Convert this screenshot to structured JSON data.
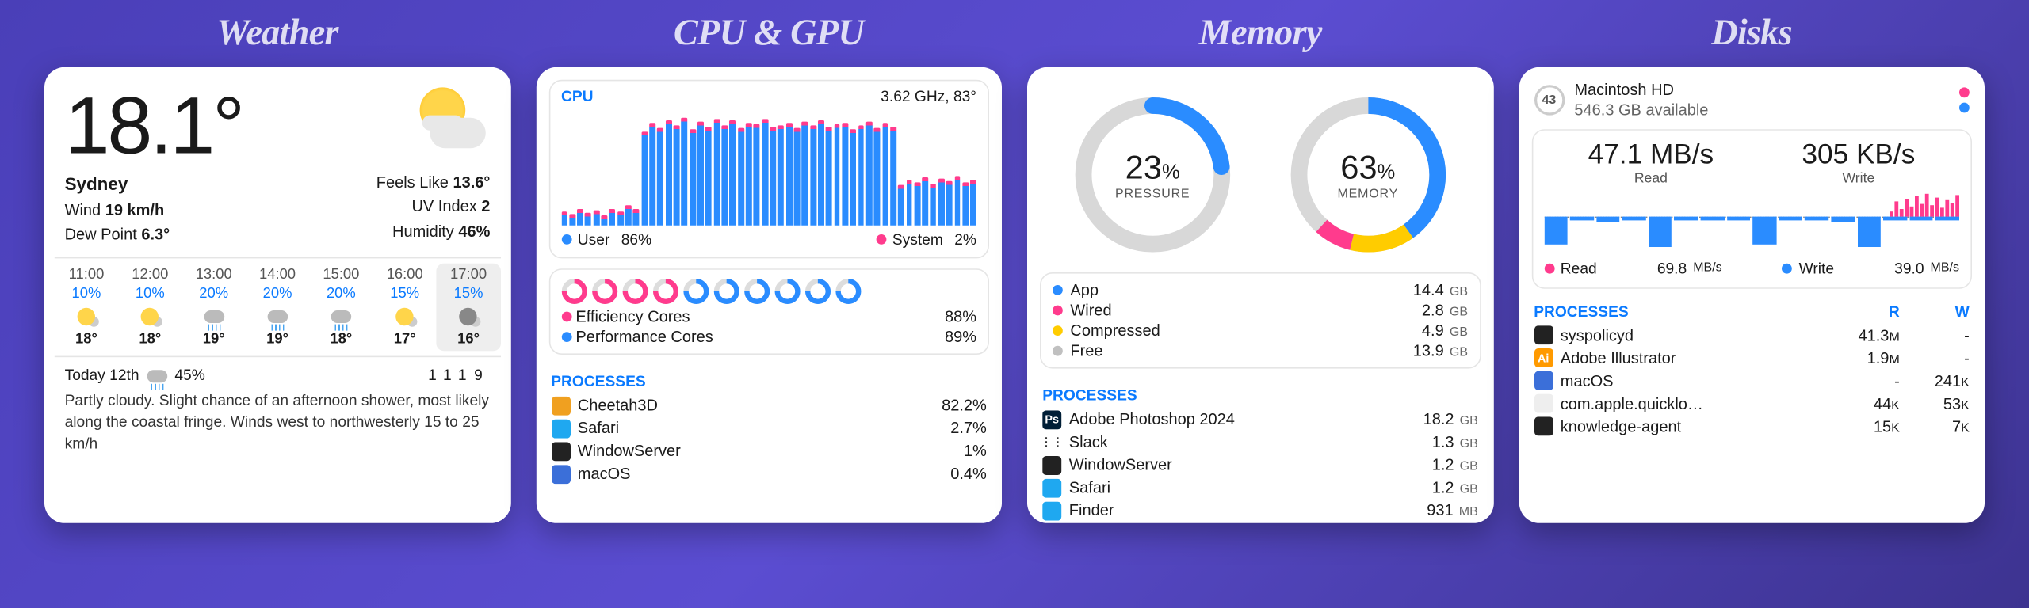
{
  "titles": {
    "weather": "Weather",
    "cpu": "CPU & GPU",
    "memory": "Memory",
    "disks": "Disks"
  },
  "weather": {
    "temp": "18.1°",
    "location": "Sydney",
    "wind_label": "Wind ",
    "wind": "19 km/h",
    "dew_label": "Dew Point ",
    "dew": "6.3°",
    "feels_label": "Feels Like ",
    "feels": "13.6°",
    "uv_label": "UV Index ",
    "uv": "2",
    "hum_label": "Humidity ",
    "hum": "46%",
    "hourly": [
      {
        "time": "11:00",
        "pop": "10%",
        "ico": "sun",
        "t": "18°"
      },
      {
        "time": "12:00",
        "pop": "10%",
        "ico": "sun",
        "t": "18°"
      },
      {
        "time": "13:00",
        "pop": "20%",
        "ico": "rain",
        "t": "19°"
      },
      {
        "time": "14:00",
        "pop": "20%",
        "ico": "rain",
        "t": "19°"
      },
      {
        "time": "15:00",
        "pop": "20%",
        "ico": "rain",
        "t": "18°"
      },
      {
        "time": "16:00",
        "pop": "15%",
        "ico": "sun",
        "t": "17°"
      },
      {
        "time": "17:00",
        "pop": "15%",
        "ico": "moon",
        "t": "16°",
        "sel": true
      }
    ],
    "today_label": "Today 12th",
    "today_pop": "45%",
    "today_lo": "11",
    "today_hi": "19",
    "today_text": "Partly cloudy. Slight chance of an afternoon shower, most likely along the coastal fringe. Winds west to northwesterly 15 to 25 km/h"
  },
  "cpu": {
    "label": "CPU",
    "freq": "3.62 GHz, 83°",
    "bars": [
      12,
      10,
      14,
      11,
      13,
      9,
      15,
      12,
      18,
      14,
      82,
      90,
      86,
      92,
      88,
      94,
      85,
      91,
      87,
      93,
      88,
      92,
      86,
      90,
      89,
      93,
      87,
      88,
      90,
      86,
      91,
      88,
      92,
      87,
      89,
      90,
      85,
      88,
      91,
      86,
      90,
      87,
      36,
      40,
      38,
      42,
      37,
      41,
      39,
      43,
      38,
      40
    ],
    "user_label": "User",
    "user_pct": "86%",
    "system_label": "System",
    "system_pct": "2%",
    "rings": [
      "p",
      "p",
      "p",
      "p",
      "b",
      "b",
      "b",
      "b",
      "b",
      "b"
    ],
    "eff_label": "Efficiency Cores",
    "eff_pct": "88%",
    "perf_label": "Performance Cores",
    "perf_pct": "89%",
    "processes_label": "PROCESSES",
    "processes": [
      {
        "name": "Cheetah3D",
        "val": "82.2%",
        "color": "#f0a020"
      },
      {
        "name": "Safari",
        "val": "2.7%",
        "color": "#1fa8f0"
      },
      {
        "name": "WindowServer",
        "val": "1%",
        "color": "#222"
      },
      {
        "name": "macOS",
        "val": "0.4%",
        "color": "#3b6fd9"
      }
    ]
  },
  "memory": {
    "pressure_val": "23",
    "pressure_unit": "%",
    "pressure_label": "PRESSURE",
    "memory_val": "63",
    "memory_unit": "%",
    "memory_label": "MEMORY",
    "rows": [
      {
        "dot": "d-blue",
        "lbl": "App",
        "val": "14.4",
        "unit": "GB"
      },
      {
        "dot": "d-pink",
        "lbl": "Wired",
        "val": "2.8",
        "unit": "GB"
      },
      {
        "dot": "d-yellow",
        "lbl": "Compressed",
        "val": "4.9",
        "unit": "GB"
      },
      {
        "dot": "d-grey",
        "lbl": "Free",
        "val": "13.9",
        "unit": "GB"
      }
    ],
    "processes_label": "PROCESSES",
    "processes": [
      {
        "name": "Adobe Photoshop 2024",
        "val": "18.2",
        "unit": "GB",
        "color": "#001e36",
        "badge": "Ps"
      },
      {
        "name": "Slack",
        "val": "1.3",
        "unit": "GB",
        "color": "#fff",
        "badge": "⋮⋮"
      },
      {
        "name": "WindowServer",
        "val": "1.2",
        "unit": "GB",
        "color": "#222"
      },
      {
        "name": "Safari",
        "val": "1.2",
        "unit": "GB",
        "color": "#1fa8f0"
      },
      {
        "name": "Finder",
        "val": "931",
        "unit": "MB",
        "color": "#1fa8f0"
      }
    ]
  },
  "disks": {
    "temp": "43",
    "name": "Macintosh HD",
    "avail": "546.3 GB available",
    "read_val": "47.1 MB/s",
    "read_label": "Read",
    "write_val": "305 KB/s",
    "write_label": "Write",
    "legend_read": "Read",
    "legend_read_val": "69.8",
    "legend_read_unit": "MB/s",
    "legend_write": "Write",
    "legend_write_val": "39.0",
    "legend_write_unit": "MB/s",
    "processes_label": "PROCESSES",
    "col_r": "R",
    "col_w": "W",
    "processes": [
      {
        "name": "syspolicyd",
        "r": "41.3",
        "ru": "M",
        "w": "-",
        "color": "#222"
      },
      {
        "name": "Adobe Illustrator",
        "r": "1.9",
        "ru": "M",
        "w": "-",
        "color": "#ff9a00",
        "badge": "Ai"
      },
      {
        "name": "macOS",
        "r": "-",
        "w": "241",
        "wu": "K",
        "color": "#3b6fd9"
      },
      {
        "name": "com.apple.quicklo…",
        "r": "44",
        "ru": "K",
        "w": "53",
        "wu": "K",
        "color": "#eee"
      },
      {
        "name": "knowledge-agent",
        "r": "15",
        "ru": "K",
        "w": "7",
        "wu": "K",
        "color": "#222"
      }
    ]
  }
}
